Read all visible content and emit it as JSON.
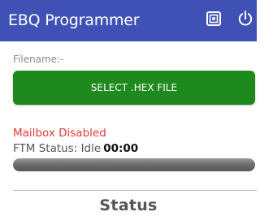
{
  "appbar": {
    "title": "EBQ Programmer",
    "background_color": "#3f51b5",
    "actions": [
      {
        "icon": "nfc-icon"
      },
      {
        "icon": "power-icon"
      }
    ]
  },
  "file": {
    "label": "Filename:-"
  },
  "select_button": {
    "label": "SELECT .HEX FILE",
    "color": "#1e8a1e"
  },
  "mailbox": {
    "status": "Mailbox Disabled",
    "color": "#e53935"
  },
  "ftm": {
    "label": "FTM Status: Idle",
    "time": "00:00"
  },
  "progress": {
    "value": 0
  },
  "status_section": {
    "title": "Status"
  }
}
